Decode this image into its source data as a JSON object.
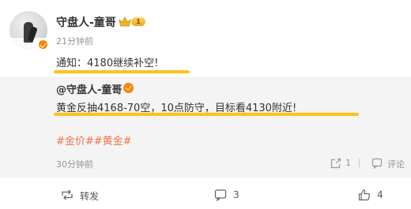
{
  "post": {
    "author": "守盘人-童哥",
    "level_badge": "1",
    "time": "21分钟前",
    "text": "通知：4180继续补空!"
  },
  "repost": {
    "author": "@守盘人-童哥",
    "text": "黄金反抽4168-70空，10点防守，目标看4130附近!",
    "tags": "#金价##黄金#",
    "time": "30分钟前",
    "share_count": "1",
    "comment_label": "评论"
  },
  "actions": {
    "repost_label": "转发",
    "comment_count": "3",
    "like_count": "4"
  },
  "colors": {
    "highlight": "#ffc21a",
    "tag": "#eb7350",
    "verified": "#ff8200",
    "repost_bg": "#f4f4f4"
  },
  "icons": [
    "verified-icon",
    "crown-level-icon",
    "share-icon",
    "comment-icon",
    "repost-icon",
    "like-icon"
  ]
}
